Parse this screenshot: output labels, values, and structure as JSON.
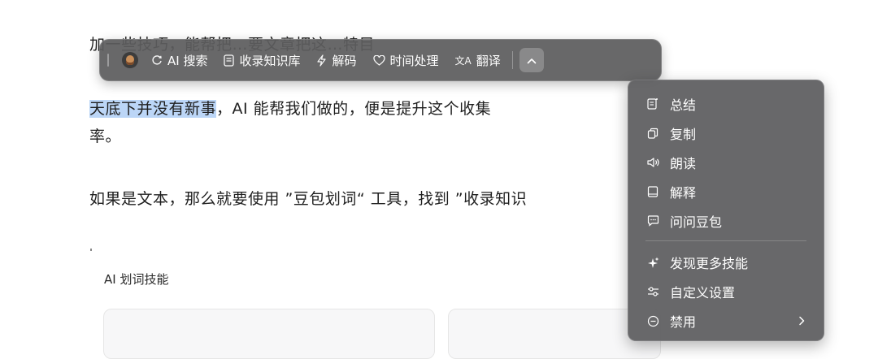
{
  "document": {
    "line1_partial": "加一些技巧，能帮把…要文章把这…特目",
    "line2_highlight": "天底下并没有新事",
    "line2_rest": "，AI 能帮我们做的，便是提升这个收集",
    "line3": "率。",
    "line4": "如果是文本，那么就要使用 ”豆包划词“ 工具，找到 ”收录知识",
    "section_label": "AI 划词技能"
  },
  "toolbar": {
    "items": [
      {
        "label": "AI 搜索",
        "icon": "ai-search-icon"
      },
      {
        "label": "收录知识库",
        "icon": "knowledge-base-icon"
      },
      {
        "label": "解码",
        "icon": "decode-icon"
      },
      {
        "label": "时间处理",
        "icon": "heart-icon"
      },
      {
        "label": "翻译",
        "icon": "translate-icon"
      }
    ],
    "toggle_icon": "chevron-up-icon"
  },
  "menu": {
    "items": [
      {
        "label": "总结",
        "icon": "summary-icon"
      },
      {
        "label": "复制",
        "icon": "copy-icon"
      },
      {
        "label": "朗读",
        "icon": "speaker-icon"
      },
      {
        "label": "解释",
        "icon": "book-icon"
      },
      {
        "label": "问问豆包",
        "icon": "chat-icon"
      }
    ],
    "items2": [
      {
        "label": "发现更多技能",
        "icon": "sparkle-icon"
      },
      {
        "label": "自定义设置",
        "icon": "sliders-icon"
      },
      {
        "label": "禁用",
        "icon": "disable-icon",
        "has_submenu": true
      }
    ]
  }
}
